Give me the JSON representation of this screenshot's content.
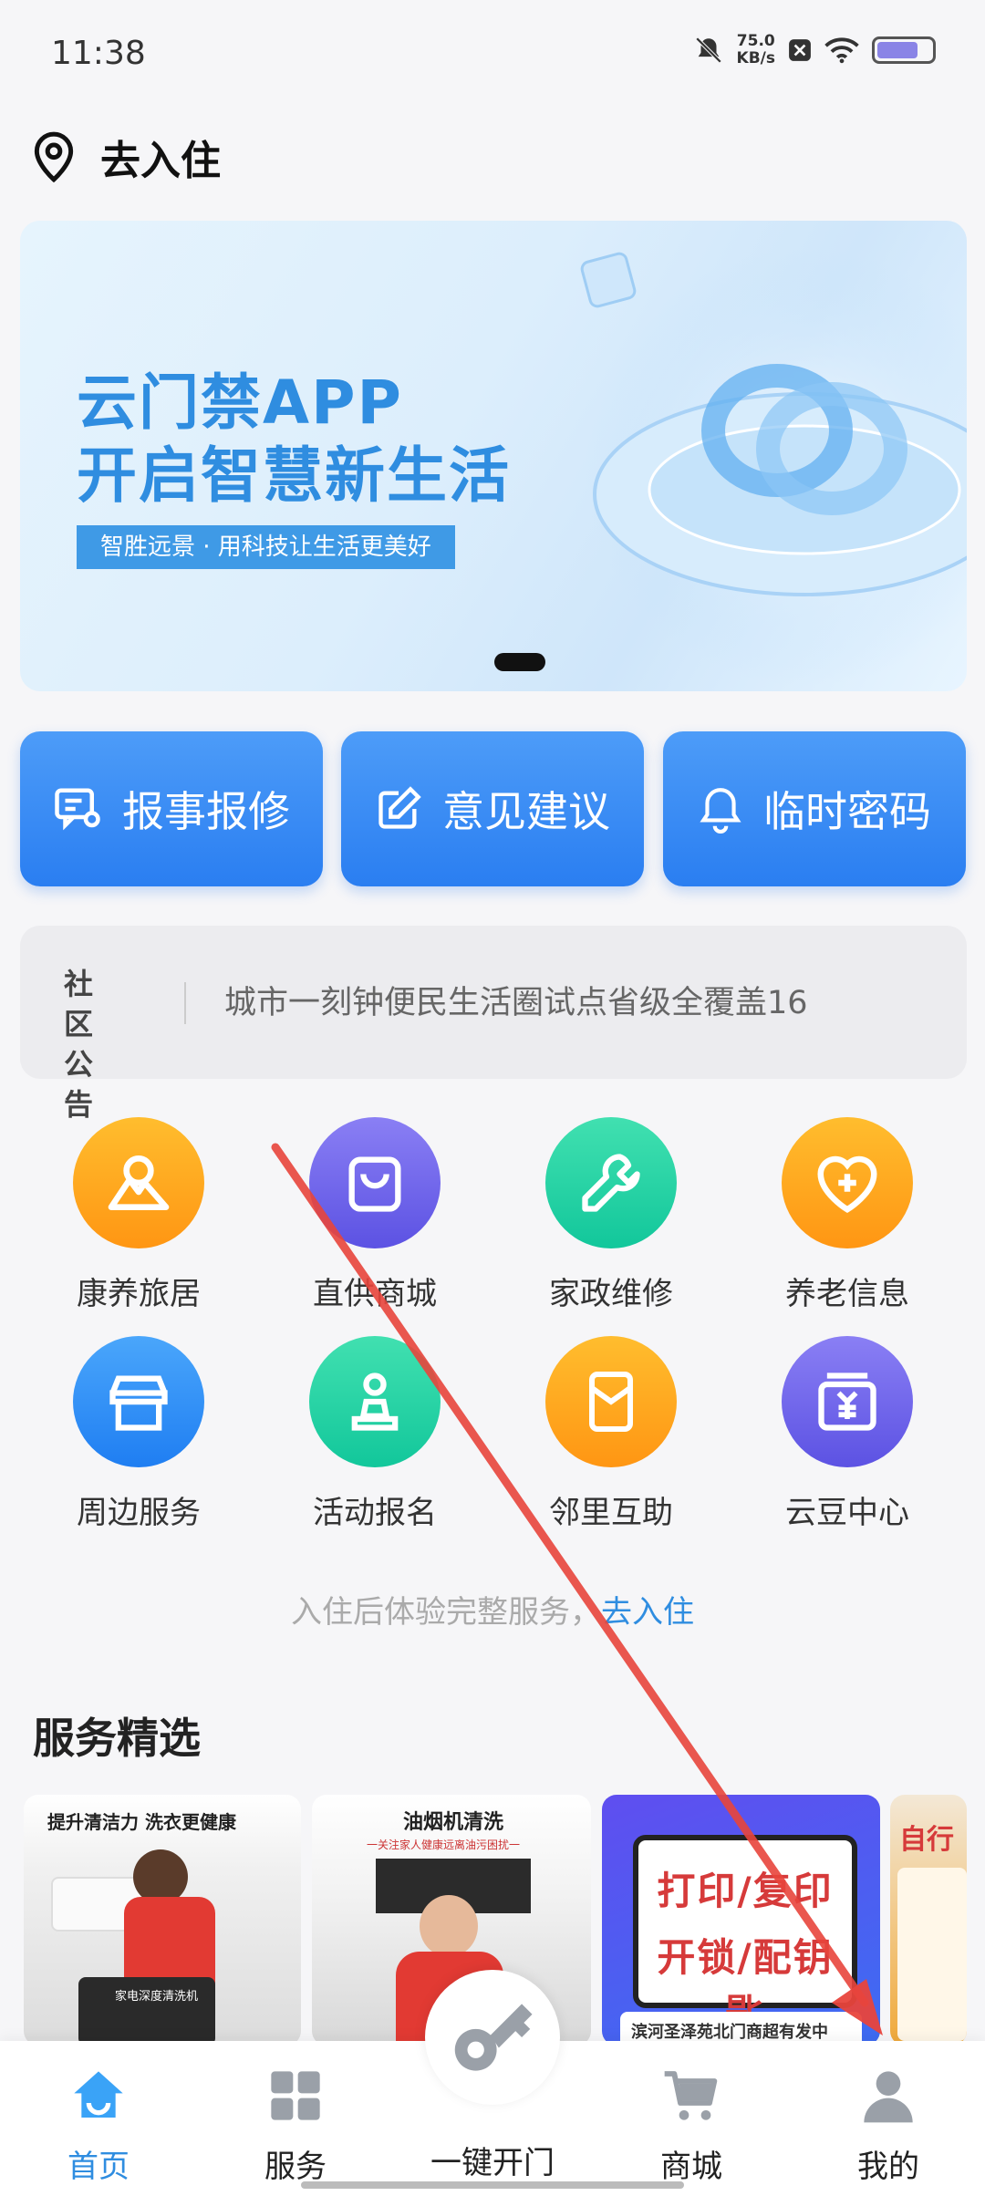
{
  "status_bar": {
    "time": "11:38",
    "net_speed_value": "75.0",
    "net_speed_unit": "KB/s",
    "battery_level": 0.75
  },
  "location": {
    "label": "去入住"
  },
  "banner": {
    "title_line1": "云门禁APP",
    "title_line2": "开启智慧新生活",
    "tagline": "智胜远景 · 用科技让生活更美好"
  },
  "quick_actions": [
    {
      "label": "报事报修",
      "icon": "report-repair-icon"
    },
    {
      "label": "意见建议",
      "icon": "edit-icon"
    },
    {
      "label": "临时密码",
      "icon": "bell-icon"
    }
  ],
  "notice": {
    "label_line1": "社区",
    "label_line2": "公告",
    "text": "城市一刻钟便民生活圈试点省级全覆盖16"
  },
  "services": [
    {
      "label": "康养旅居",
      "icon": "mountain-icon",
      "color": "#ff9d1a"
    },
    {
      "label": "直供商城",
      "icon": "shopping-bag-icon",
      "color": "#6a60ea"
    },
    {
      "label": "家政维修",
      "icon": "wrench-icon",
      "color": "#1ecfa2"
    },
    {
      "label": "养老信息",
      "icon": "heart-plus-icon",
      "color": "#ff9d1a"
    },
    {
      "label": "周边服务",
      "icon": "store-icon",
      "color": "#2f86f4"
    },
    {
      "label": "活动报名",
      "icon": "chess-pawn-icon",
      "color": "#1ecfa2"
    },
    {
      "label": "邻里互助",
      "icon": "envelope-icon",
      "color": "#ff9d1a"
    },
    {
      "label": "云豆中心",
      "icon": "yuan-card-icon",
      "color": "#6a60ea"
    }
  ],
  "hint": {
    "text": "入住后体验完整服务，",
    "link": "去入住"
  },
  "featured": {
    "title": "服务精选",
    "cards": [
      {
        "headline": "提升清洁力 洗衣更健康",
        "sub": "家电深度清洗机"
      },
      {
        "headline": "油烟机清洗",
        "sub": "一关注家人健康远离油污困扰一"
      },
      {
        "line1": "打印/复印",
        "line2": "开锁/配钥匙",
        "footer": "滨河圣泽苑北门商超有发中"
      },
      {
        "headline": "自行"
      }
    ]
  },
  "bottom_nav": [
    {
      "label": "首页",
      "icon": "home-icon"
    },
    {
      "label": "服务",
      "icon": "grid-icon"
    },
    {
      "label": "一键开门",
      "icon": "key-icon"
    },
    {
      "label": "商城",
      "icon": "cart-icon"
    },
    {
      "label": "我的",
      "icon": "user-icon"
    }
  ],
  "colors": {
    "accent": "#2f8de0",
    "button_blue": "#2a7ef1",
    "annotation_red": "#e8453c"
  }
}
